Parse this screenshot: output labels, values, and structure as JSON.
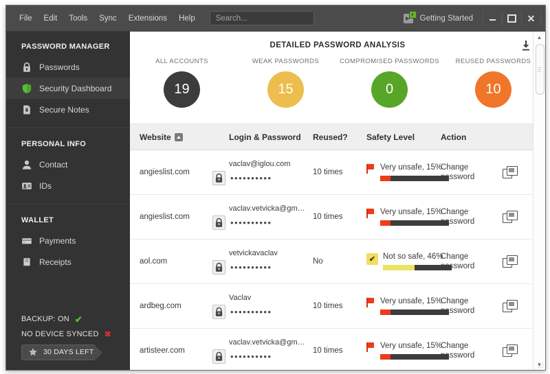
{
  "titlebar": {
    "menu": [
      "File",
      "Edit",
      "Tools",
      "Sync",
      "Extensions",
      "Help"
    ],
    "search_placeholder": "Search...",
    "getting_started": "Getting Started",
    "minimize": "–",
    "maximize": "□",
    "close": "✕"
  },
  "sidebar": {
    "sections": [
      {
        "heading": "PASSWORD MANAGER",
        "items": [
          {
            "label": "Passwords",
            "icon": "lock-icon",
            "active": false
          },
          {
            "label": "Security Dashboard",
            "icon": "shield-icon",
            "active": true
          },
          {
            "label": "Secure Notes",
            "icon": "note-icon",
            "active": false
          }
        ]
      },
      {
        "heading": "PERSONAL INFO",
        "items": [
          {
            "label": "Contact",
            "icon": "person-icon",
            "active": false
          },
          {
            "label": "IDs",
            "icon": "id-card-icon",
            "active": false
          }
        ]
      },
      {
        "heading": "WALLET",
        "items": [
          {
            "label": "Payments",
            "icon": "credit-card-icon",
            "active": false
          },
          {
            "label": "Receipts",
            "icon": "receipt-icon",
            "active": false
          }
        ]
      }
    ],
    "footer": {
      "backup": "BACKUP: ON",
      "backup_state": "✔",
      "sync": "NO DEVICE SYNCED",
      "sync_state": "✖",
      "trial": "30 DAYS LEFT",
      "trial_icon": "star-icon"
    }
  },
  "analysis": {
    "title": "DETAILED PASSWORD ANALYSIS",
    "export_icon": "download-icon",
    "stats": [
      {
        "caption": "ALL ACCOUNTS",
        "value": "19",
        "color": "#3c3c3c"
      },
      {
        "caption": "WEAK PASSWORDS",
        "value": "15",
        "color": "#edbd4e"
      },
      {
        "caption": "COMPROMISED PASSWORDS",
        "value": "0",
        "color": "#57a627"
      },
      {
        "caption": "REUSED PASSWORDS",
        "value": "10",
        "color": "#f0762a"
      }
    ]
  },
  "table": {
    "columns": [
      "Website",
      "Login & Password",
      "Reused?",
      "Safety Level",
      "Action"
    ],
    "sort_icon": "sort-ascending-icon",
    "rows": [
      {
        "website": "angieslist.com",
        "login": "vaclav@iglou.com",
        "password_mask": "••••••••••",
        "reused": "10 times",
        "safety_text": "Very unsafe, 15%",
        "safety_percent": 15,
        "safety_color": "#ef3b18",
        "status_icon": "red-flag-icon",
        "action": "Change password",
        "open_icon": "open-in-window-icon"
      },
      {
        "website": "angieslist.com",
        "login": "vaclav.vetvicka@gma...",
        "password_mask": "••••••••••",
        "reused": "10 times",
        "safety_text": "Very unsafe, 15%",
        "safety_percent": 15,
        "safety_color": "#ef3b18",
        "status_icon": "red-flag-icon",
        "action": "Change password",
        "open_icon": "open-in-window-icon"
      },
      {
        "website": "aol.com",
        "login": "vetvickavaclav",
        "password_mask": "••••••••••",
        "reused": "No",
        "safety_text": "Not so safe, 46%",
        "safety_percent": 46,
        "safety_color": "#ece461",
        "status_icon": "yellow-check-icon",
        "action": "Change password",
        "open_icon": "open-in-window-icon"
      },
      {
        "website": "ardbeg.com",
        "login": "Vaclav",
        "password_mask": "••••••••••",
        "reused": "10 times",
        "safety_text": "Very unsafe, 15%",
        "safety_percent": 15,
        "safety_color": "#ef3b18",
        "status_icon": "red-flag-icon",
        "action": "Change password",
        "open_icon": "open-in-window-icon"
      },
      {
        "website": "artisteer.com",
        "login": "vaclav.vetvicka@gma...",
        "password_mask": "••••••••••",
        "reused": "10 times",
        "safety_text": "Very unsafe, 15%",
        "safety_percent": 15,
        "safety_color": "#ef3b18",
        "status_icon": "red-flag-icon",
        "action": "Change password",
        "open_icon": "open-in-window-icon"
      }
    ]
  },
  "scrollbar": {
    "up": "▲",
    "down": "▼"
  }
}
